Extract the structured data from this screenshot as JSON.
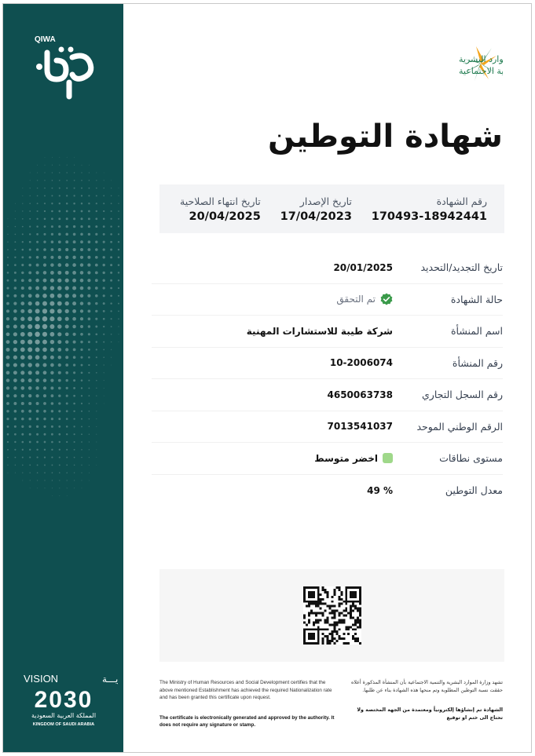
{
  "sidebar": {
    "brand_name": "QIWA",
    "vision": {
      "title_en": "VISION",
      "title_ar": "رؤيـــة",
      "year": "2030",
      "kingdom_ar": "المملكة العربية السعودية",
      "kingdom_en": "KINGDOM OF SAUDI ARABIA"
    }
  },
  "header": {
    "ministry_line1": "الموارد البشرية",
    "ministry_line2": "والتنمية الاجتماعية",
    "title": "شهادة التوطين"
  },
  "summary": [
    {
      "label": "رقم الشهادة",
      "value": "170493-18942441"
    },
    {
      "label": "تاريخ الإصدار",
      "value": "17/04/2023"
    },
    {
      "label": "تاريخ انتهاء الصلاحية",
      "value": "20/04/2025"
    }
  ],
  "details": [
    {
      "label": "تاريخ التجديد/التحديد",
      "value": "20/01/2025"
    },
    {
      "label": "حالة الشهادة",
      "value": "تم التحقق",
      "icon": "verified-check-icon"
    },
    {
      "label": "اسم المنشأة",
      "value": "شركة طيبة للاستشارات المهنية"
    },
    {
      "label": "رقم المنشأة",
      "value": "10-2006074"
    },
    {
      "label": "رقم السجل التجاري",
      "value": "4650063738"
    },
    {
      "label": "الرقم الوطني الموحد",
      "value": "7013541037"
    },
    {
      "label": "مستوى نطاقات",
      "value": "اخضر متوسط",
      "icon": "nitaqat-green-icon"
    },
    {
      "label": "معدل التوطين",
      "value": "% 49"
    }
  ],
  "qr": {
    "icon": "qr-code-icon"
  },
  "footer": {
    "en_statement": "The Ministry of Human Resources and Social Development certifies that the above mentioned Establishment has achieved the required Nationalization rate and has been granted this certificate upon request.",
    "en_note": "The certificate is electronically generated and approved by the authority. It does not require any signature or stamp.",
    "ar_statement": "تشهد وزارة الموارد البشرية والتنمية الاجتماعية بأن المنشأة المذكورة أعلاه حققت نسبة التوطين المطلوبة وتم منحها هذه الشهادة بناء عن طلبها.",
    "ar_note": "الشهادة تم إنشاؤها إلكترونياً ومعتمدة من الجهة المختصة ولا تحتاج الى ختم او توقيع"
  },
  "colors": {
    "sidebar": "#0f4f50",
    "nitaqat_green": "#9fd88a",
    "verified_green": "#3a9a4a",
    "ministry_green": "#1e7a4f",
    "ministry_orange": "#f4a51c"
  }
}
